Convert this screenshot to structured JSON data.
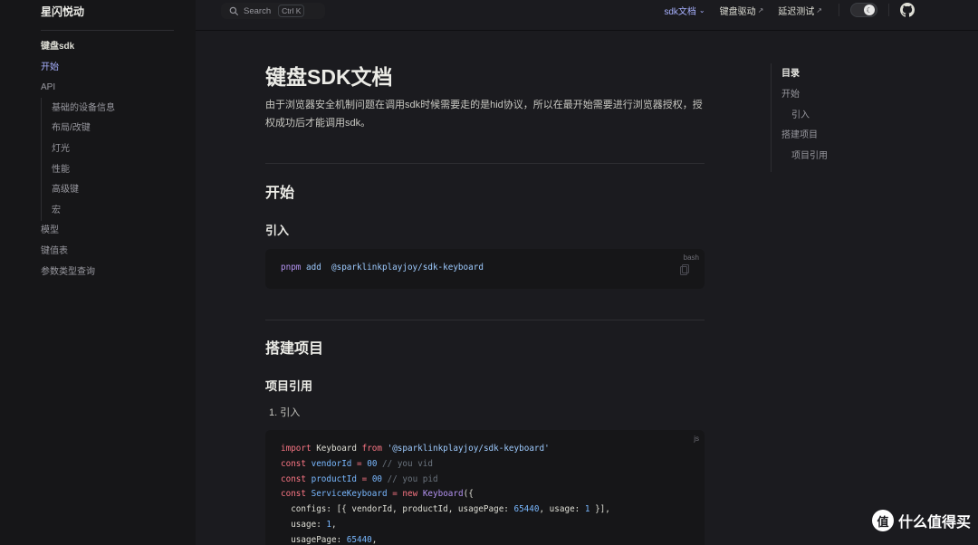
{
  "site": {
    "title": "星闪悦动"
  },
  "sidebar": {
    "items": [
      {
        "label": "键盘sdk"
      },
      {
        "label": "开始"
      },
      {
        "label": "API"
      },
      {
        "label": "基础的设备信息"
      },
      {
        "label": "布局/改键"
      },
      {
        "label": "灯光"
      },
      {
        "label": "性能"
      },
      {
        "label": "高级键"
      },
      {
        "label": "宏"
      },
      {
        "label": "模型"
      },
      {
        "label": "键值表"
      },
      {
        "label": "参数类型查询"
      }
    ]
  },
  "topnav": {
    "search_label": "Search",
    "search_shortcut": "Ctrl K",
    "links": [
      {
        "label": "sdk文档"
      },
      {
        "label": "键盘驱动"
      },
      {
        "label": "延迟测试"
      }
    ]
  },
  "doc": {
    "title": "键盘SDK文档",
    "intro": "由于浏览器安全机制问题在调用sdk时候需要走的是hid协议，所以在最开始需要进行浏览器授权，授权成功后才能调用sdk。",
    "section_start": "开始",
    "section_import": "引入",
    "code1": {
      "lang": "bash",
      "cmd": "pnpm",
      "sub": "add",
      "pkg": "@sparklinkplayjoy/sdk-keyboard"
    },
    "section_build": "搭建项目",
    "section_ref": "项目引用",
    "list_item": "1. 引入",
    "code2": {
      "lang": "js",
      "kw_import": "import",
      "ident_keyboard": "Keyboard",
      "kw_from": "from",
      "str_pkg": "'@sparklinkplayjoy/sdk-keyboard'",
      "kw_const": "const",
      "var_vendor": "vendorId",
      "var_product": "productId",
      "var_service": "ServiceKeyboard",
      "num_00": "00",
      "cm_vid": "// you vid",
      "cm_pid": "// you pid",
      "kw_new": "new",
      "fn_keyboard": "Keyboard",
      "l5_pre": "configs: [{ vendorId, productId, usagePage: ",
      "num_65440": "65440",
      "l5_mid": ", usage: ",
      "num_1": "1",
      "l5_end": " }],",
      "l6_pre": "usage: ",
      "l6_end": ",",
      "l7_pre": "usagePage: ",
      "l7_end": ","
    }
  },
  "toc": {
    "title": "目录",
    "items": [
      {
        "label": "开始"
      },
      {
        "label": "引入"
      },
      {
        "label": "搭建项目"
      },
      {
        "label": "项目引用"
      }
    ]
  },
  "watermark": {
    "text": "什么值得买",
    "logo_char": "值"
  }
}
